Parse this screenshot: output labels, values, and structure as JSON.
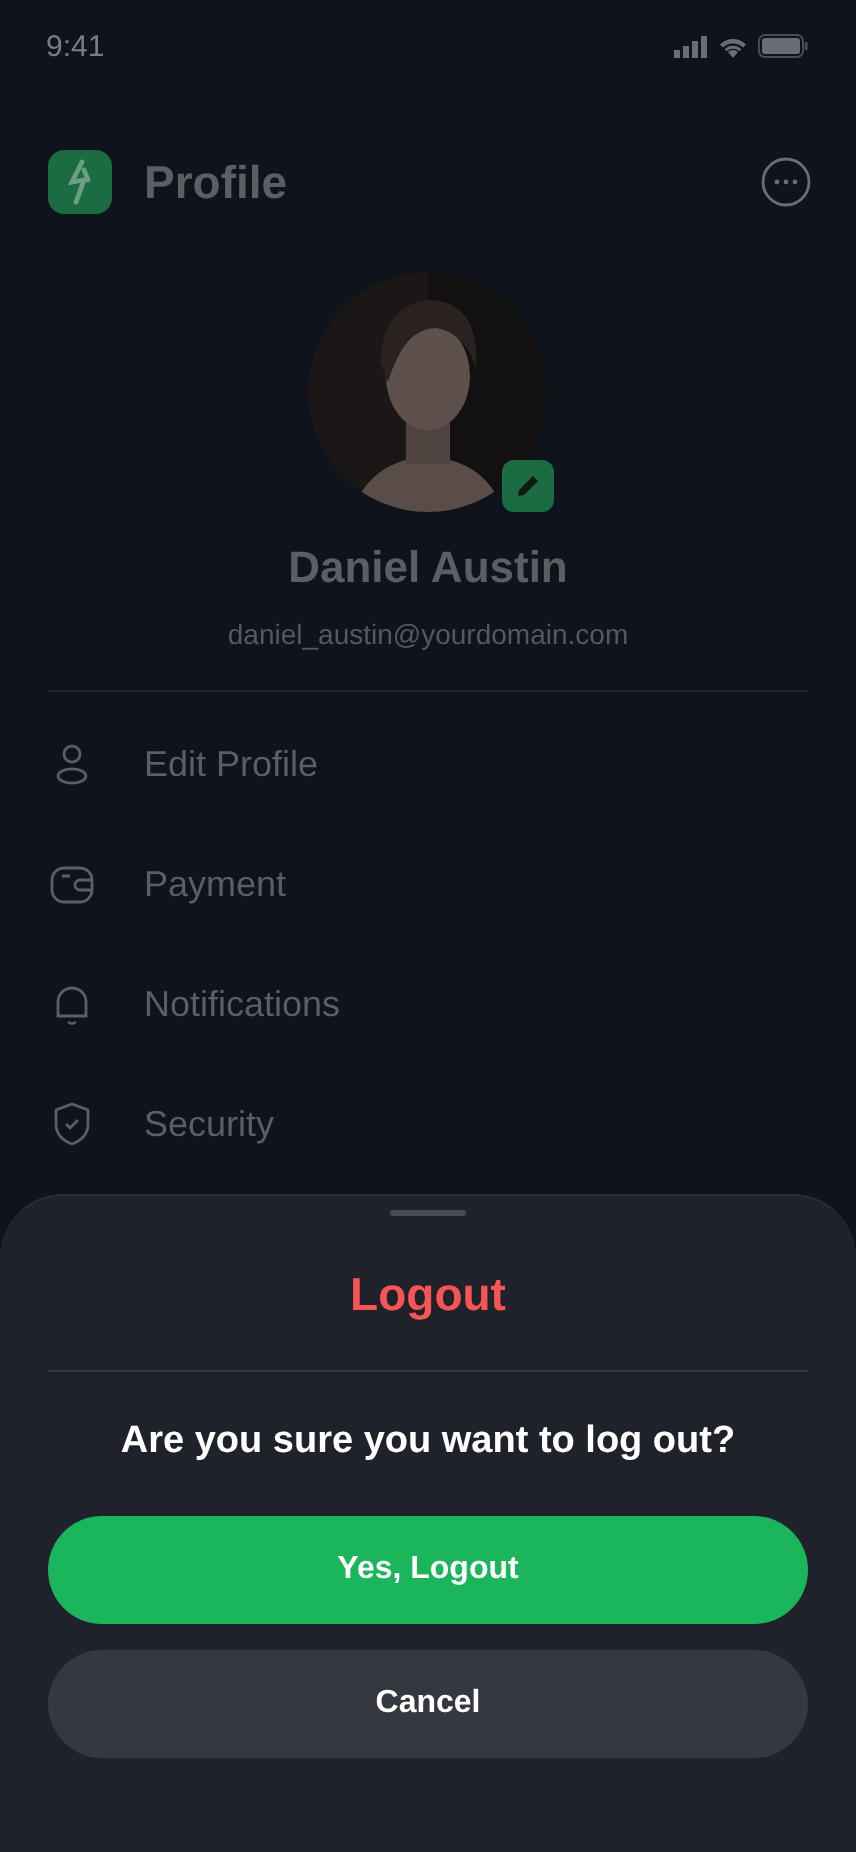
{
  "status_bar": {
    "time": "9:41"
  },
  "header": {
    "title": "Profile"
  },
  "profile": {
    "name": "Daniel Austin",
    "email": "daniel_austin@yourdomain.com"
  },
  "menu": [
    {
      "label": "Edit Profile"
    },
    {
      "label": "Payment"
    },
    {
      "label": "Notifications"
    },
    {
      "label": "Security"
    }
  ],
  "sheet": {
    "title": "Logout",
    "message": "Are you sure you want to log out?",
    "buttons": [
      {
        "label": "Yes, Logout",
        "kind": "primary"
      },
      {
        "label": "Cancel",
        "kind": "secondary"
      }
    ]
  }
}
